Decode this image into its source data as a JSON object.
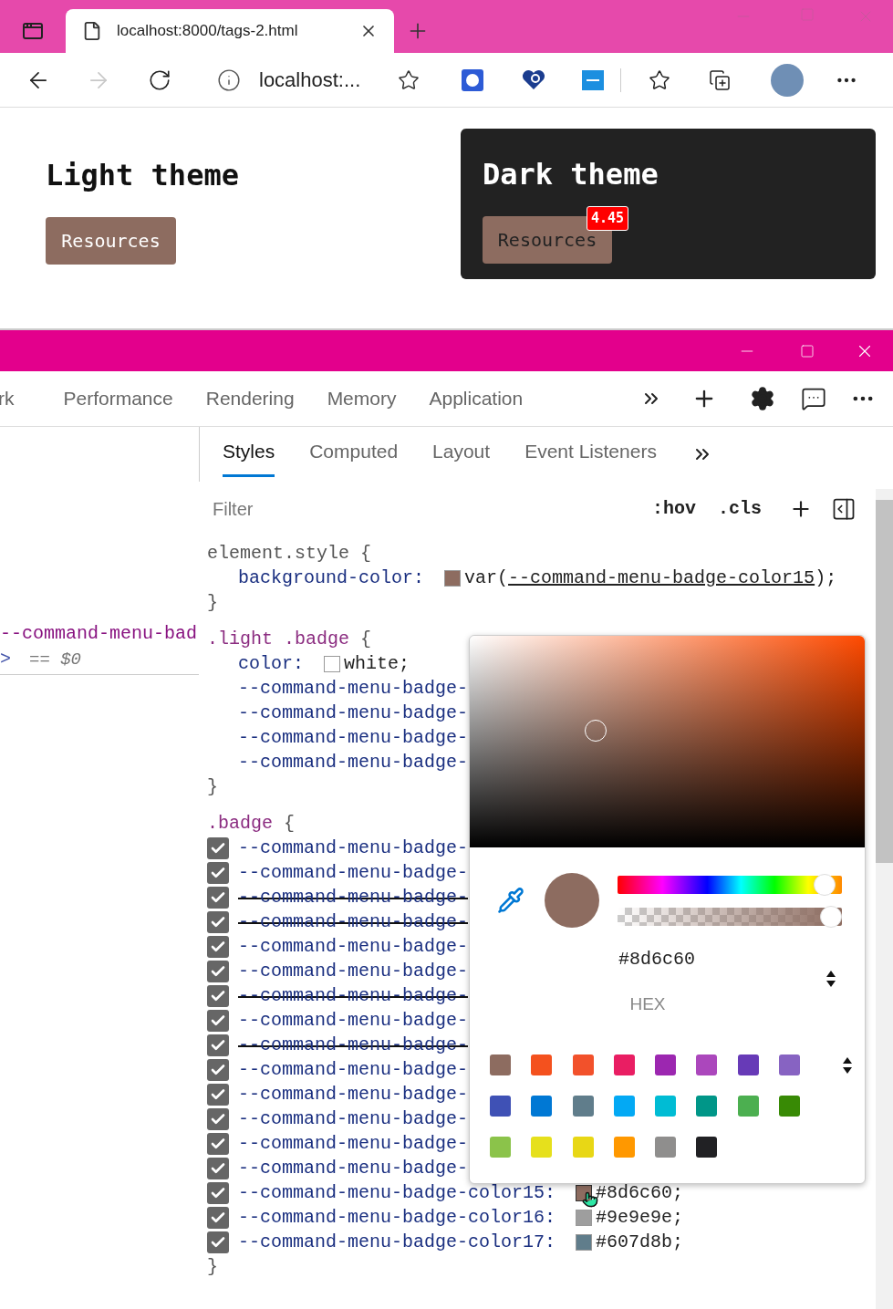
{
  "browser": {
    "tab_title": "localhost:8000/tags-2.html",
    "address": "localhost:...",
    "forward_disabled": true
  },
  "page": {
    "light": {
      "heading": "Light theme",
      "badge": "Resources"
    },
    "dark": {
      "heading": "Dark theme",
      "badge": "Resources",
      "contrast": "4.45"
    }
  },
  "devtools": {
    "tabs": [
      {
        "label": "rk",
        "selected": false
      },
      {
        "label": "Performance",
        "selected": false
      },
      {
        "label": "Rendering",
        "selected": false
      },
      {
        "label": "Memory",
        "selected": false
      },
      {
        "label": "Application",
        "selected": false
      }
    ],
    "elements": {
      "node_text": "--command-menu-bad",
      "tag_end": ">",
      "ref": "== $0"
    },
    "styles_tabs": [
      {
        "label": "Styles",
        "selected": true
      },
      {
        "label": "Computed",
        "selected": false
      },
      {
        "label": "Layout",
        "selected": false
      },
      {
        "label": "Event Listeners",
        "selected": false
      }
    ],
    "filter": {
      "placeholder": "Filter"
    },
    "hov": ":hov",
    "cls": ".cls",
    "rules": [
      {
        "selector": "element.style",
        "open": "{",
        "close": "}",
        "declarations": [
          {
            "kind": "var",
            "name": "background-color:",
            "color": "#8d6c60",
            "value": "var(",
            "link": "--command-menu-badge-color15",
            "value_end": ");"
          }
        ]
      },
      {
        "selector": ".light .badge",
        "open": "{",
        "close": "}",
        "declarations": [
          {
            "kind": "plain",
            "name": "color:",
            "color": "#ffffff",
            "value": "white;"
          },
          {
            "kind": "plain",
            "name": "--command-menu-badge-"
          },
          {
            "kind": "plain",
            "name": "--command-menu-badge-"
          },
          {
            "kind": "plain",
            "name": "--command-menu-badge-"
          },
          {
            "kind": "plain",
            "name": "--command-menu-badge-"
          }
        ]
      },
      {
        "selector": ".badge",
        "open": "{",
        "close": "}",
        "declarations": [
          {
            "kind": "check",
            "name": "--command-menu-badge-",
            "checked": true,
            "struck": false
          },
          {
            "kind": "check",
            "name": "--command-menu-badge-",
            "checked": true,
            "struck": false
          },
          {
            "kind": "check",
            "name": "--command-menu-badge-",
            "checked": true,
            "struck": true
          },
          {
            "kind": "check",
            "name": "--command-menu-badge-",
            "checked": true,
            "struck": true
          },
          {
            "kind": "check",
            "name": "--command-menu-badge-",
            "checked": true,
            "struck": false
          },
          {
            "kind": "check",
            "name": "--command-menu-badge-",
            "checked": true,
            "struck": false
          },
          {
            "kind": "check",
            "name": "--command-menu-badge-",
            "checked": true,
            "struck": true
          },
          {
            "kind": "check",
            "name": "--command-menu-badge-",
            "checked": true,
            "struck": false
          },
          {
            "kind": "check",
            "name": "--command-menu-badge-",
            "checked": true,
            "struck": true
          },
          {
            "kind": "check",
            "name": "--command-menu-badge-",
            "checked": true,
            "struck": false
          },
          {
            "kind": "check",
            "name": "--command-menu-badge-",
            "checked": true,
            "struck": false
          },
          {
            "kind": "check",
            "name": "--command-menu-badge-",
            "checked": true,
            "struck": false
          },
          {
            "kind": "check",
            "name": "--command-menu-badge-",
            "checked": true,
            "struck": false
          },
          {
            "kind": "check",
            "name": "--command-menu-badge-",
            "checked": true,
            "struck": false
          },
          {
            "kind": "check",
            "name": "--command-menu-badge-color15:",
            "color": "#8d6c60",
            "value": "#8d6c60;",
            "checked": true,
            "struck": false,
            "hovered": true
          },
          {
            "kind": "check",
            "name": "--command-menu-badge-color16:",
            "color": "#9e9e9e",
            "value": "#9e9e9e;",
            "checked": true,
            "struck": false,
            "hovered": false
          },
          {
            "kind": "check",
            "name": "--command-menu-badge-color17:",
            "color": "#607d8b",
            "value": "#607d8b;",
            "checked": true,
            "struck": false,
            "hovered": false
          }
        ]
      }
    ],
    "picker": {
      "color": "#8d6c60",
      "hue": {
        "level": 0.97
      },
      "alpha": {
        "level": 1
      },
      "value": "#8d6c60",
      "format": "HEX",
      "palette": [
        {
          "color": "#8d6c60"
        },
        {
          "color": "#f4511e"
        },
        {
          "color": "#f2512b"
        },
        {
          "color": "#e91e63"
        },
        {
          "color": "#9c27b0"
        },
        {
          "color": "#ab47bc"
        },
        {
          "color": "#673ab7"
        },
        {
          "color": "#8763c2"
        },
        {
          "color": "#3f51b5"
        },
        {
          "color": "#0078d4"
        },
        {
          "color": "#607d8b"
        },
        {
          "color": "#03a9f4"
        },
        {
          "color": "#00bcd4"
        },
        {
          "color": "#009688"
        },
        {
          "color": "#4caf50"
        },
        {
          "color": "#388a05"
        },
        {
          "color": "#8bc34a"
        },
        {
          "color": "#e6e01c"
        },
        {
          "color": "#e8d715"
        },
        {
          "color": "#ff9800"
        },
        {
          "color": "#8f8e8d"
        },
        {
          "color": "#212124"
        }
      ]
    }
  }
}
